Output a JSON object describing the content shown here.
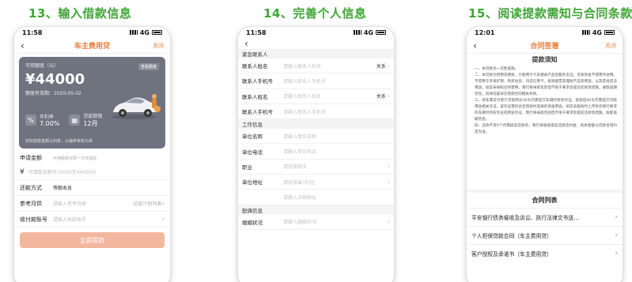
{
  "steps": [
    {
      "title": "13、输入借款信息"
    },
    {
      "title": "14、完善个人信息"
    },
    {
      "title": "15、阅读提款需知与合同条款"
    }
  ],
  "phone1": {
    "status": {
      "time": "11:58",
      "net": "4G"
    },
    "nav": {
      "title": "车主费用贷",
      "close": "关闭"
    },
    "card": {
      "limit_label": "可用额度（元）",
      "amount": "¥44000",
      "date": "额度有效期：2020-05-02",
      "badge": "查看额度",
      "rate_label": "年利率",
      "rate_value": "7.00%",
      "term_label": "贷款期限",
      "term_value": "12月",
      "note": "实际放款金额以利率，以最终审批为准"
    },
    "form": {
      "apply_label": "申请金额",
      "apply_hint": "可用额度仅限一次性提取",
      "amount_placeholder": "可请款金额为10000至44000元",
      "repay_label": "还款方式",
      "repay_value": "等额本息",
      "ref_label": "参考月供",
      "ref_placeholder": "请输入参考月供",
      "ref_right": "还款计划列表",
      "account_label": "收付款账号",
      "account_placeholder": "请输入收款账号",
      "submit": "立即提款"
    }
  },
  "phone2": {
    "status": {
      "time": "11:58",
      "net": "4G"
    },
    "sections": {
      "emergency": "紧急联系人",
      "work": "工作信息",
      "marriage": "配偶信息"
    },
    "emergency_rows": [
      {
        "label": "联系人姓名",
        "placeholder": "请输入联系人姓名",
        "relation": "关系"
      },
      {
        "label": "联系人手机号",
        "placeholder": "请输入联系人手机号",
        "relation": ""
      },
      {
        "label": "联系人姓名",
        "placeholder": "请输入联系人姓名",
        "relation": "关系"
      },
      {
        "label": "联系人手机号",
        "placeholder": "请输入联系人手机号",
        "relation": ""
      }
    ],
    "work_rows": [
      {
        "label": "单位名称",
        "placeholder": "请输入单位名称"
      },
      {
        "label": "单位电话",
        "placeholder": "请输入单位电话"
      },
      {
        "label": "职业",
        "placeholder": "请选择职业"
      },
      {
        "label": "单位地址",
        "placeholder": "请选择省/市/区"
      },
      {
        "label": "",
        "placeholder": "请输入详细地址"
      }
    ],
    "marriage_row": {
      "label": "婚姻状况",
      "placeholder": "请输入婚姻状况"
    }
  },
  "phone3": {
    "status": {
      "time": "12:01",
      "net": "4G"
    },
    "nav": {
      "title": "合同签署",
      "close": "关闭"
    },
    "notice_title": "提款须知",
    "terms": [
      "一、本贷款为一次性提款。",
      "二、本贷款为借用消费款，只能用于汽车相关产品及服务支出，贷款资金不得用作他用。不得用于开采矿物、购买住房、归还信用卡、投资股票及理财产品等用途。以及其他违法用途。如您未按照合同使用，我行将采取包括但不限于要求您提前还款等措施，收取逾期罚息。具体内容详见借款合同相关条款。",
      "三、购车需支付客户贷款到达30天内需提交车辆时有权凭证，提款后60天内需提交贷款用途相关凭证，该凭证需符合您借款时选择的资金用途。如您未能按时上传符合我行要求的车辆时有权凭证或用途凭证，我行将采取包括但不限于要求您提前还款等措施，收取逾期罚息。",
      "四、还款不足0个月需提前还款的，我行将收取提前还款违约金，具体金额以贷款合同约定为准。"
    ],
    "list_title": "合同列表",
    "contracts": [
      "平安银行债务催收及诉讼、执行法律文书送…",
      "个人担保贷款合同（车主费用贷）",
      "客户授权及承诺书（车主费用贷）"
    ]
  }
}
